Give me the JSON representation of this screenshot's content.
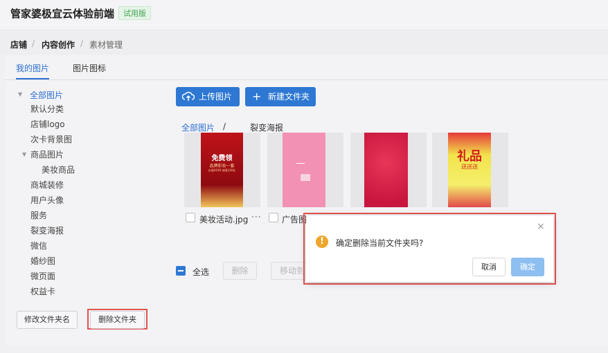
{
  "header": {
    "app_title": "管家婆极宜云体验前端",
    "badge": "试用版"
  },
  "breadcrumb": {
    "item1": "店铺",
    "sep1": "/",
    "item2": "内容创作",
    "sep2": "/",
    "item3": "素材管理"
  },
  "tabs": {
    "my_images": "我的图片",
    "image_icons": "图片图标"
  },
  "sidebar": {
    "root": "全部图片",
    "items": [
      "默认分类",
      "店铺logo",
      "次卡背景图",
      "商品图片",
      "美妆商品",
      "商城装修",
      "用户头像",
      "服务",
      "裂变海报",
      "微信",
      "婚纱图",
      "微页面",
      "权益卡"
    ],
    "rename_button": "修改文件夹名",
    "delete_button": "删除文件夹"
  },
  "toolbar": {
    "upload": "上传图片",
    "new_folder": "新建文件夹"
  },
  "path": {
    "root": "全部图片",
    "sep": "/",
    "current": "裂变海报"
  },
  "thumbnails": [
    {
      "name": "美妆活动.jpg",
      "more": "···",
      "poster_line1": "免费领",
      "poster_line2": "品牌彩妆一套",
      "poster_line3": "价值¥199 仅限100名"
    },
    {
      "name": "广告图",
      "poster_line1": "",
      "poster_line2": "",
      "poster_line3": ""
    },
    {
      "name": "",
      "poster_line1": "",
      "poster_line2": "",
      "poster_line3": ""
    },
    {
      "name": "",
      "poster_line1": "礼品",
      "poster_line2": "送送送",
      "poster_line3": ""
    }
  ],
  "footer": {
    "select_all": "全选",
    "delete": "删除",
    "move": "移动到"
  },
  "dialog": {
    "close": "×",
    "message": "确定删除当前文件夹吗?",
    "cancel": "取消",
    "confirm": "确定"
  },
  "colors": {
    "accent": "#2e78d3",
    "danger_frame": "#e3524f",
    "warning": "#f0a52b",
    "trial_badge": "#3fa34d"
  }
}
